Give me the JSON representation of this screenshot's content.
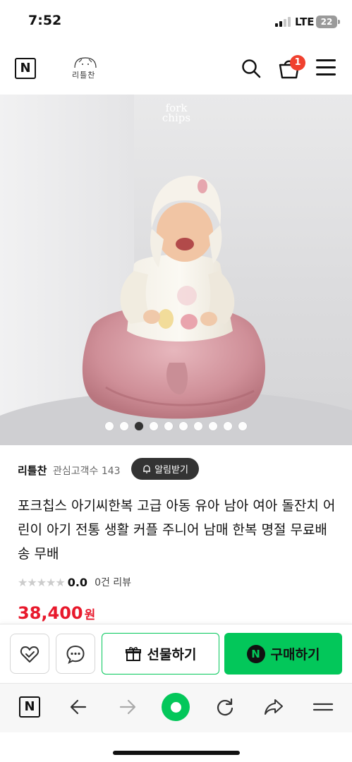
{
  "status_bar": {
    "time": "7:52",
    "network": "LTE",
    "battery": "22"
  },
  "header": {
    "logo_text": "리틀찬",
    "cart_count": "1",
    "naver_mark": "N"
  },
  "hero": {
    "brand_line1": "fork",
    "brand_line2": "chips",
    "dots_total": 10,
    "dots_active": 3
  },
  "store": {
    "name": "리틀찬",
    "followers": "관심고객수 143",
    "alarm_label": "알림받기"
  },
  "product": {
    "title": "포크칩스 아기씨한복 고급 아동 유아 남아 여아 돌잔치 어린이 아기 전통 생활 커플 주니어 남매 한복 명절 무료배송 무배",
    "rating_score": "0.0",
    "review_count": "0건 리뷰",
    "price": "38,400",
    "price_unit": "원"
  },
  "actions": {
    "gift_label": "선물하기",
    "buy_label": "구매하기",
    "buy_mark": "N"
  },
  "toolbar": {
    "n_label": "N"
  },
  "colors": {
    "naver_green": "#03c75a",
    "price_red": "#e8192c",
    "badge_red": "#f0412f"
  }
}
